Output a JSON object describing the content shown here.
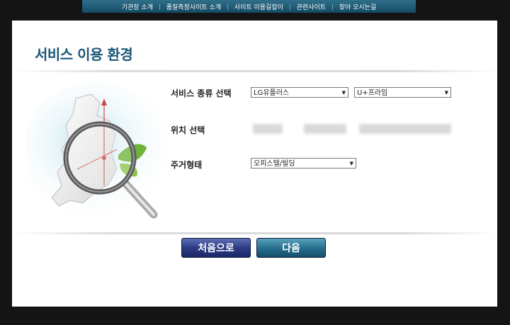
{
  "topnav": {
    "items": [
      "기관장 소개",
      "품질측정사이트 소개",
      "사이트 이용길잡이",
      "관련사이트",
      "찾아 오시는길"
    ],
    "separator": "|"
  },
  "page": {
    "title": "서비스 이용 환경"
  },
  "form": {
    "service_type": {
      "label": "서비스 종류 선택",
      "provider": "LG유플러스",
      "product": "U+프라임"
    },
    "location": {
      "label": "위치 선택"
    },
    "housing": {
      "label": "주거형태",
      "value": "오피스텔/빌딩"
    }
  },
  "buttons": {
    "first": "처음으로",
    "next": "다음"
  },
  "colors": {
    "title": "#1a5677",
    "nav_bg": "#1f5a75",
    "btn_first": "#2d3b86",
    "btn_next": "#27708f"
  },
  "icons": {
    "illustration": "magnifier-over-korea-map-icon",
    "dropdown": "dropdown-arrow-icon"
  }
}
